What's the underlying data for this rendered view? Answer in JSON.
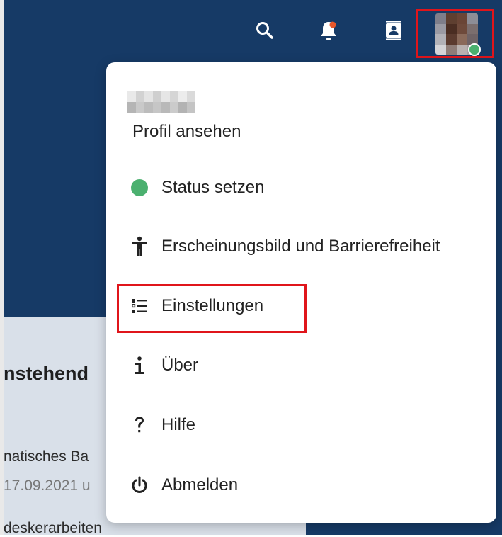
{
  "header": {
    "icons": [
      "search-icon",
      "bell-icon",
      "contacts-icon"
    ],
    "notification_dot_color": "#e8572a",
    "avatar_status_color": "#4bb06f"
  },
  "background": {
    "heading": "nstehend",
    "line1": "natisches Ba",
    "line2": "17.09.2021 u",
    "line3": "deskerarbeiten"
  },
  "menu": {
    "profile_link": "Profil ansehen",
    "items": [
      {
        "icon": "status-dot-icon",
        "label": "Status setzen"
      },
      {
        "icon": "accessibility-icon",
        "label": "Erscheinungsbild und Barrierefreiheit"
      },
      {
        "icon": "settings-list-icon",
        "label": "Einstellungen"
      },
      {
        "icon": "info-icon",
        "label": "Über"
      },
      {
        "icon": "help-icon",
        "label": "Hilfe"
      },
      {
        "icon": "power-icon",
        "label": "Abmelden"
      }
    ]
  },
  "colors": {
    "header_bg": "#163a66",
    "highlight_border": "#e0151b",
    "status_green": "#4bb06f"
  }
}
